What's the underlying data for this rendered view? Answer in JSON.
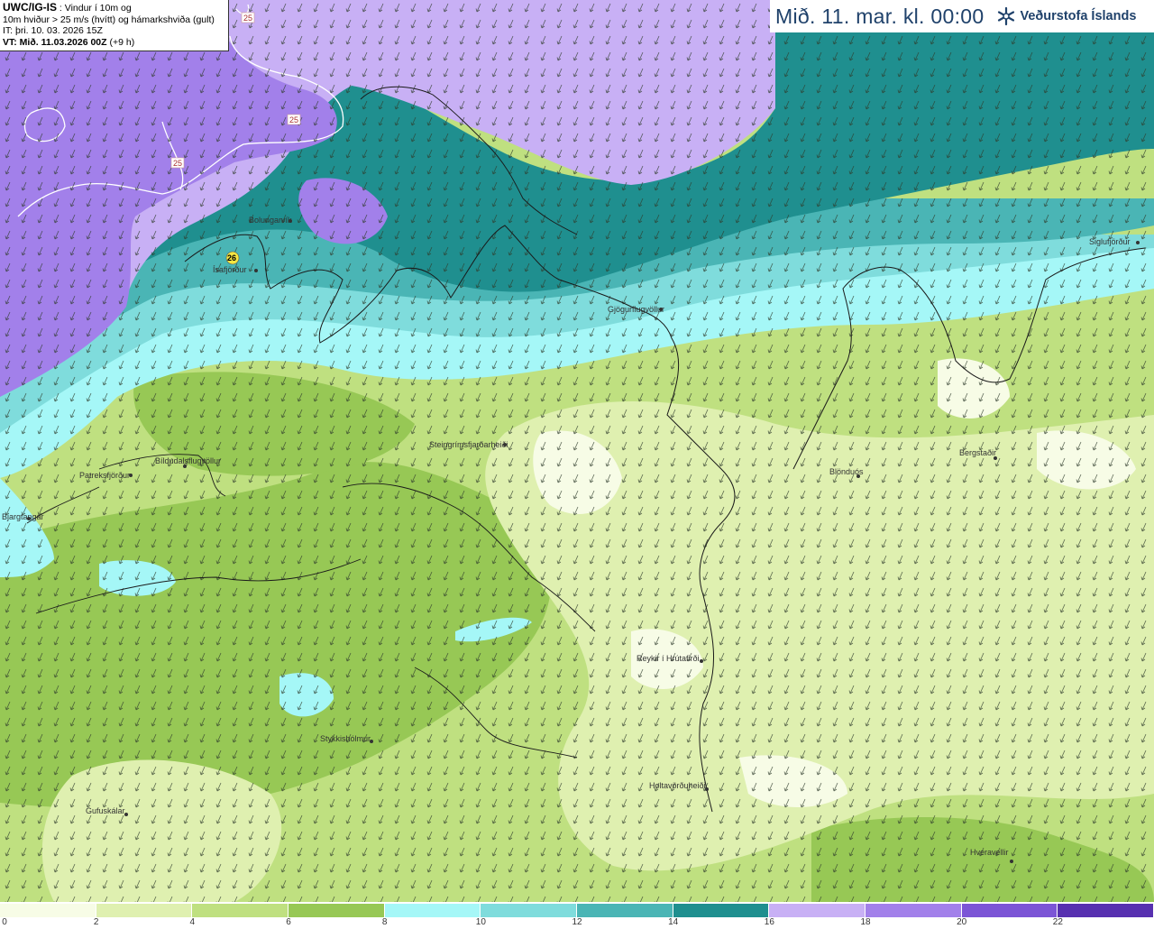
{
  "header": {
    "valid_time": "Mið. 11. mar. kl. 00:00",
    "logo_text": "Veðurstofa Íslands"
  },
  "info_box": {
    "model": "UWC/IG-IS",
    "line1": " : Vindur í 10m og",
    "line2": "10m hviður > 25 m/s (hvítt) og hámarkshviða (gult)",
    "line3": "IT: þri. 10. 03. 2026 15Z",
    "line4_label": "VT: Mið. 11.03.2026 00Z",
    "line4_suffix": " (+9 h)"
  },
  "legend": {
    "colors": [
      "#f7fce6",
      "#dff0b0",
      "#bfe080",
      "#97c855",
      "#a5f7f7",
      "#7fdcdc",
      "#4ab5b5",
      "#1f8f8f",
      "#c8b0f5",
      "#a280ea",
      "#7c55d6",
      "#5730b0"
    ],
    "labels": [
      "0",
      "2",
      "4",
      "6",
      "8",
      "10",
      "12",
      "14",
      "16",
      "18",
      "20",
      "22"
    ]
  },
  "places": [
    {
      "name": "Bolungarvík"
    },
    {
      "name": "Ísafjörður"
    },
    {
      "name": "Gjögurflugvöllur"
    },
    {
      "name": "Siglufjörður"
    },
    {
      "name": "Bíldudalsflugvöllur"
    },
    {
      "name": "Patreksfjörður"
    },
    {
      "name": "Bjargtangar"
    },
    {
      "name": "Steingrímsfjarðarheiði"
    },
    {
      "name": "Blönduós"
    },
    {
      "name": "Bergstaðir"
    },
    {
      "name": "Reykir í Hrútafirði"
    },
    {
      "name": "Stykkishólmur"
    },
    {
      "name": "Holtavörðuheiði"
    },
    {
      "name": "Gufuskálar"
    },
    {
      "name": "Hveravellir"
    }
  ],
  "map": {
    "gust_contour_labels": [
      "25",
      "25",
      "25"
    ],
    "max_gust": "26"
  }
}
